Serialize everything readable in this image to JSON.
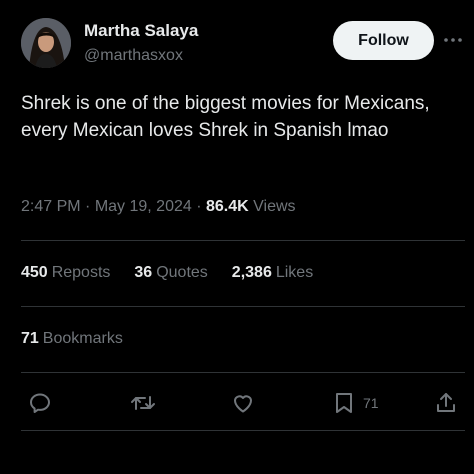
{
  "author": {
    "display_name": "Martha Salaya",
    "handle": "@marthasxox"
  },
  "header": {
    "follow_label": "Follow",
    "more_icon": "more-horizontal-icon"
  },
  "tweet": {
    "text": "Shrek is one of the biggest movies for Mexicans, every Mexican loves Shrek in Spanish lmao"
  },
  "meta": {
    "time": "2:47 PM",
    "separator": " · ",
    "date": "May 19, 2024",
    "views_count": "86.4K",
    "views_label": "Views"
  },
  "stats": {
    "reposts_count": "450",
    "reposts_label": "Reposts",
    "quotes_count": "36",
    "quotes_label": "Quotes",
    "likes_count": "2,386",
    "likes_label": "Likes"
  },
  "bookmarks": {
    "count": "71",
    "label": "Bookmarks"
  },
  "actions": {
    "reply_icon": "reply-icon",
    "repost_icon": "repost-icon",
    "like_icon": "heart-icon",
    "bookmark_icon": "bookmark-icon",
    "bookmark_count": "71",
    "share_icon": "share-icon"
  },
  "colors": {
    "background": "#000000",
    "text_primary": "#e7e9ea",
    "text_secondary": "#71767b",
    "divider": "#2f3336",
    "follow_bg": "#eff3f4"
  }
}
